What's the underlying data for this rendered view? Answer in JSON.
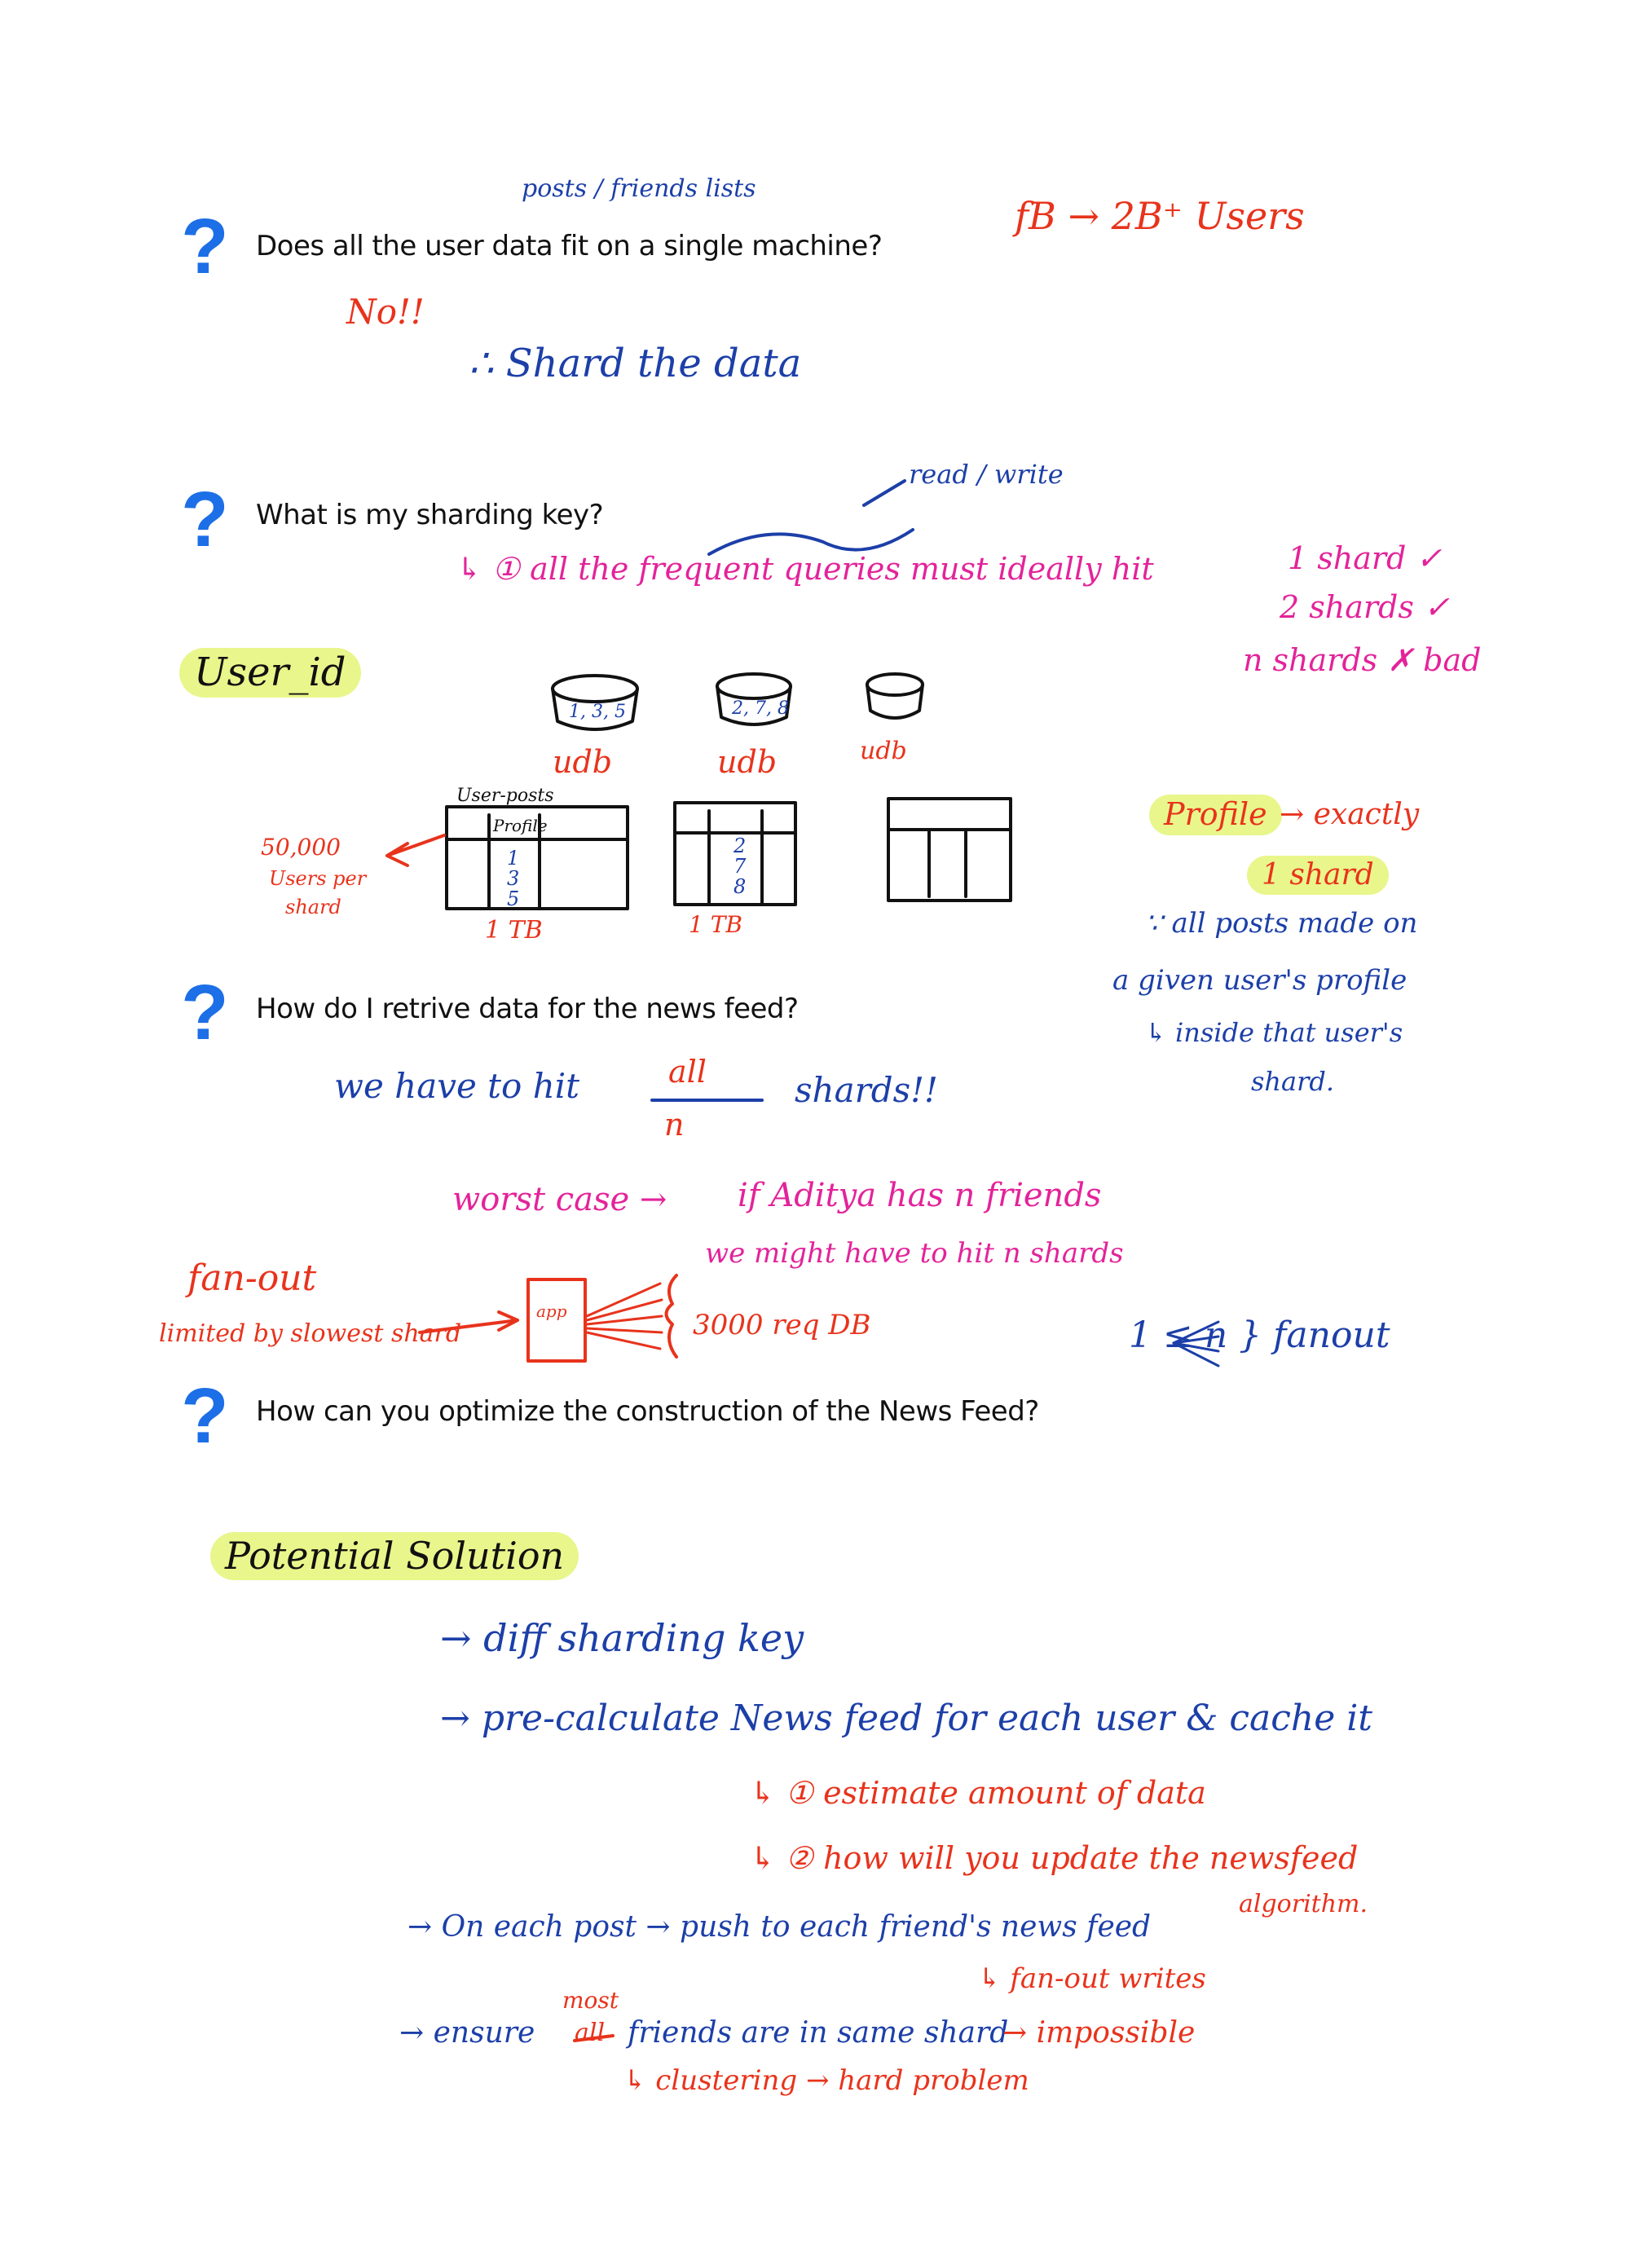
{
  "questions": [
    {
      "mark": "?",
      "text": "Does all the user data fit on a single machine?"
    },
    {
      "mark": "?",
      "text": "What is my sharding key?"
    },
    {
      "mark": "?",
      "text": "How do I retrive data for the news feed?"
    },
    {
      "mark": "?",
      "text": "How can you optimize the construction of the News Feed?"
    }
  ],
  "notes": {
    "posts_friends": "posts / friends lists",
    "fb_users": "fB → 2B⁺ Users",
    "no": "No!!",
    "shard_data": "∴ Shard the data",
    "read_write": "read / write",
    "frequent_queries": "↳ ① all the frequent queries must ideally hit",
    "one_shard": "1 shard ✓",
    "two_shards": "2 shards ✓",
    "n_shards": "n shards ✗ bad",
    "user_id": "User_id",
    "db_labels": [
      "udb",
      "udb",
      "udb"
    ],
    "db_ids": [
      "1, 3, 5",
      "2, 7, 8"
    ],
    "table_header": "User-posts",
    "table_sub": "Profile",
    "table_ids_1": [
      "1",
      "3",
      "5"
    ],
    "table_ids_2": [
      "2",
      "7",
      "8"
    ],
    "tb_1": "1 TB",
    "tb_2": "1 TB",
    "users_per_shard": [
      "50,000",
      "Users per",
      "shard"
    ],
    "profile": "Profile",
    "exactly": "→ exactly",
    "one_shard_hl": "1 shard",
    "all_posts": "∵ all posts made on",
    "given_user": "a given user's profile",
    "inside_shard": "↳ inside that user's",
    "shard": "shard.",
    "hit_all": "we have to hit",
    "all": "all",
    "n": "n",
    "shards": "shards!!",
    "worst_case": "worst case →",
    "if_aditya": "if Aditya has n friends",
    "might_hit": "we might have to hit n shards",
    "fan_out": "fan-out",
    "limited": "limited by slowest shard",
    "app": "app",
    "req": "3000 req DB",
    "fanout_formula": "1 ≤ n } fanout",
    "potential": "Potential Solution",
    "diff_key": "→ diff sharding key",
    "precalc": "→ pre-calculate News feed for each user & cache it",
    "estimate": "↳ ① estimate amount of data",
    "update": "↳ ② how will you update the newsfeed",
    "algorithm": "algorithm.",
    "on_each_post": "→ On each post → push to each friend's news feed",
    "fanout_writes": "↳ fan-out writes",
    "ensure": "→ ensure",
    "most": "most",
    "all_struck": "all",
    "friends_same": "friends are in same shard",
    "impossible": "→ impossible",
    "clustering": "↳ clustering → hard problem"
  },
  "colors": {
    "question_mark": "#1c6fe6",
    "ink_blue": "#1c3fa8",
    "ink_red": "#e8331c",
    "ink_pink": "#e3239a",
    "ink_black": "#111111",
    "highlight": "#e9f68b"
  }
}
